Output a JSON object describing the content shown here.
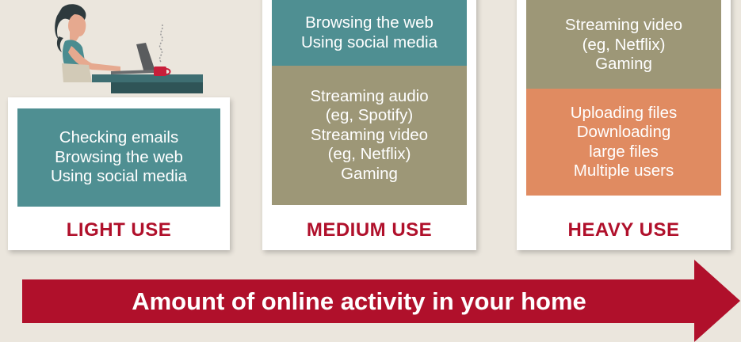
{
  "illustration": {
    "icon": "person-at-laptop-icon"
  },
  "light": {
    "items": [
      "Checking emails",
      "Browsing the web",
      "Using social media"
    ],
    "label": "LIGHT USE"
  },
  "medium": {
    "top_items": [
      "Browsing the web",
      "Using social media"
    ],
    "bottom_items": [
      "Streaming audio",
      "(eg, Spotify)",
      "Streaming video",
      "(eg, Netflix)",
      "Gaming"
    ],
    "label": "MEDIUM USE"
  },
  "heavy": {
    "top_items": [
      "Streaming video",
      "(eg, Netflix)",
      "Gaming"
    ],
    "bottom_items": [
      "Uploading files",
      "Downloading",
      "large files",
      "Multiple users"
    ],
    "label": "HEAVY USE"
  },
  "arrow": {
    "text": "Amount of online activity in your home"
  },
  "colors": {
    "background": "#ebe6dd",
    "teal": "#4f8f92",
    "olive": "#9d9777",
    "orange": "#e08b61",
    "accent": "#b0102b"
  }
}
